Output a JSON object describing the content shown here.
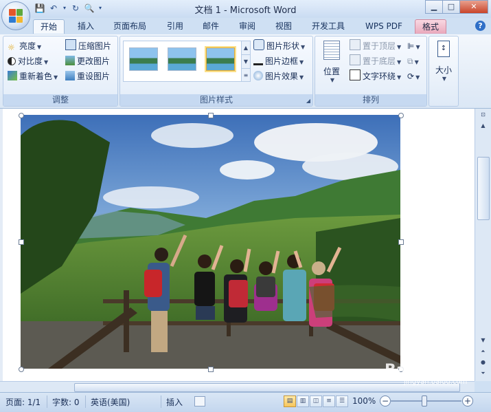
{
  "window": {
    "title": "文档 1 - Microsoft Word"
  },
  "tabs": [
    {
      "label": "开始",
      "state": "active"
    },
    {
      "label": "插入"
    },
    {
      "label": "页面布局"
    },
    {
      "label": "引用"
    },
    {
      "label": "邮件"
    },
    {
      "label": "审阅"
    },
    {
      "label": "视图"
    },
    {
      "label": "开发工具"
    },
    {
      "label": "WPS PDF"
    },
    {
      "label": "格式",
      "state": "contextual"
    }
  ],
  "ribbon": {
    "adjust": {
      "label": "调整",
      "brightness": "亮度",
      "contrast": "对比度",
      "recolor": "重新着色",
      "compress": "压缩图片",
      "change": "更改图片",
      "reset": "重设图片"
    },
    "styles": {
      "label": "图片样式",
      "shape": "图片形状",
      "border": "图片边框",
      "effects": "图片效果"
    },
    "arrange": {
      "label": "排列",
      "position": "位置",
      "bring_front": "置于顶层",
      "send_back": "置于底层",
      "text_wrap": "文字环绕"
    },
    "size": {
      "label": "大小"
    }
  },
  "status": {
    "page": "页面: 1/1",
    "words": "字数: 0",
    "language": "英语(美国)",
    "mode": "插入",
    "zoom": "100%"
  },
  "watermark": {
    "text": "Baidu经验",
    "url": "jingyan.baidu.com"
  }
}
